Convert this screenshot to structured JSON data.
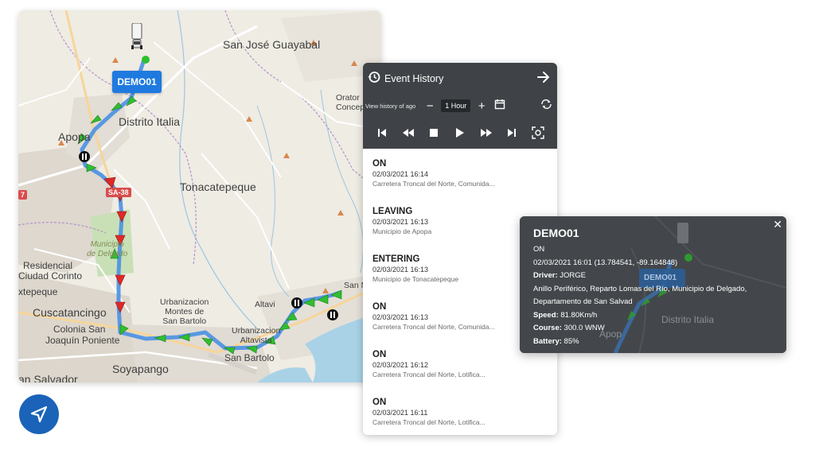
{
  "map": {
    "vehicle_tag": "DEMO01",
    "labels": {
      "san_jose": "San José Guayabal",
      "distrito_italia": "Distrito Italia",
      "apopa": "Apopa",
      "tonacatepeque": "Tonacatepeque",
      "oratorio": "Orator",
      "concep": "Concep",
      "residencial": "Residencial",
      "ciudad_corinto": "Ciudad Corinto",
      "mejicanos": "xtepeque",
      "cuscatancingo": "Cuscatancingo",
      "colonia": "Colonia San",
      "joaquin": "Joaquín Poniente",
      "soyapango": "Soyapango",
      "san_salvador": "an Salvador",
      "urbanizacion_montes": "Urbanizacion\nMontes de\nSan Bartolo",
      "altavista": "Altavi",
      "urbanizacion_altavista": "Urbanizacion\nAltavista",
      "san_bartolo": "San Bartolo",
      "san_m": "San M",
      "municipio_delgado": "Municipio\nde Delgado",
      "road_sa38": "SA-38",
      "road_7": "7"
    },
    "icons": {
      "truck": "truck-icon",
      "navigate": "navigation-arrow-icon"
    }
  },
  "history": {
    "title": "Event History",
    "view_label": "View history of ago",
    "hour_value": "1 Hour",
    "events": [
      {
        "title": "ON",
        "time": "02/03/2021 16:14",
        "place": "Carretera Troncal del Norte, Comunida..."
      },
      {
        "title": "LEAVING",
        "time": "02/03/2021 16:13",
        "place": "Municipio de Apopa"
      },
      {
        "title": "ENTERING",
        "time": "02/03/2021 16:13",
        "place": "Municipio de Tonacatepeque"
      },
      {
        "title": "ON",
        "time": "02/03/2021 16:13",
        "place": "Carretera Troncal del Norte, Comunida..."
      },
      {
        "title": "ON",
        "time": "02/03/2021 16:12",
        "place": "Carretera Troncal del Norte, Lotifica..."
      },
      {
        "title": "ON",
        "time": "02/03/2021 16:11",
        "place": "Carretera Troncal del Norte, Lotifica..."
      }
    ]
  },
  "popup": {
    "title": "DEMO01",
    "status": "ON",
    "datetime_coords": "02/03/2021 16:01 (13.784541, -89.164848)",
    "driver_label": "Driver:",
    "driver_value": "JORGE",
    "address_line1": "Anillo Periférico, Reparto Lomas del Río, Municipio de Delgado,",
    "address_line2": "Departamento de San Salvad",
    "speed_label": "Speed:",
    "speed_value": "81.80Km/h",
    "course_label": "Course:",
    "course_value": "300.0 WNW",
    "battery_label": "Battery:",
    "battery_value": "85%",
    "bg_map_label": "Distrito Italia",
    "bg_map_tag": "DEMO01",
    "bg_map_apopa": "Apop"
  },
  "colors": {
    "route_blue": "#4a90e2",
    "arrow_green": "#2fbf2f",
    "arrow_red": "#e02828",
    "panel_dark": "#3f4347",
    "tag_blue": "#1f7ae0",
    "nav_blue": "#1b63b8"
  }
}
